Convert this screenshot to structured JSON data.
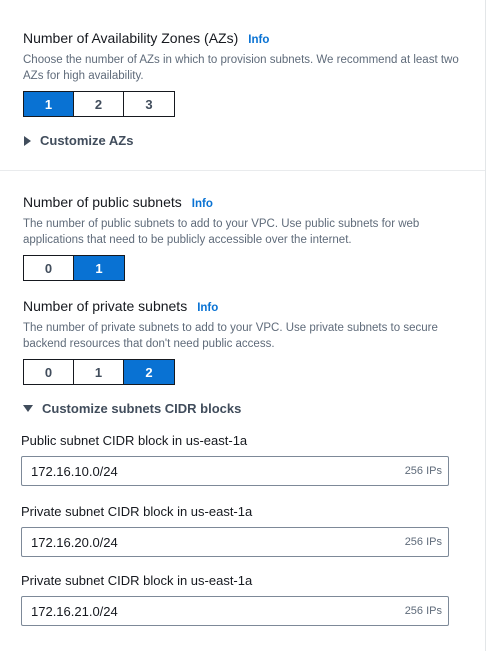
{
  "azs": {
    "title": "Number of Availability Zones (AZs)",
    "info": "Info",
    "description": "Choose the number of AZs in which to provision subnets. We recommend at least two AZs for high availability.",
    "options": [
      "1",
      "2",
      "3"
    ],
    "selected": "1",
    "customize_label": "Customize AZs"
  },
  "public_subnets": {
    "title": "Number of public subnets",
    "info": "Info",
    "description": "The number of public subnets to add to your VPC. Use public subnets for web applications that need to be publicly accessible over the internet.",
    "options": [
      "0",
      "1"
    ],
    "selected": "1"
  },
  "private_subnets": {
    "title": "Number of private subnets",
    "info": "Info",
    "description": "The number of private subnets to add to your VPC. Use private subnets to secure backend resources that don't need public access.",
    "options": [
      "0",
      "1",
      "2"
    ],
    "selected": "2"
  },
  "cidr": {
    "customize_label": "Customize subnets CIDR blocks",
    "fields": [
      {
        "label": "Public subnet CIDR block in us-east-1a",
        "value": "172.16.10.0/24",
        "ips": "256 IPs"
      },
      {
        "label": "Private subnet CIDR block in us-east-1a",
        "value": "172.16.20.0/24",
        "ips": "256 IPs"
      },
      {
        "label": "Private subnet CIDR block in us-east-1a",
        "value": "172.16.21.0/24",
        "ips": "256 IPs"
      }
    ]
  },
  "colors": {
    "accent": "#0972d3",
    "text": "#16191f",
    "muted": "#5f6b7a"
  }
}
